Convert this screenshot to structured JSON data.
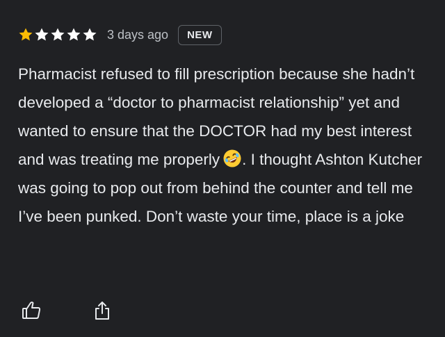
{
  "review": {
    "rating": 1,
    "max_rating": 5,
    "time_ago": "3 days ago",
    "badge": "NEW",
    "text_part1": "Pharmacist refused to fill prescription because she hadn’t developed a “doctor to pharmacist relationship” yet and wanted to ensure that the DOCTOR had my best interest and was treating me properly",
    "emoji": "rolling-on-floor-laughing-emoji",
    "text_part2": ". I thought Ashton Kutcher was going to pop out from behind the counter and tell me I’ve been punked. Don’t waste your time, place is a joke"
  },
  "actions": {
    "like_icon": "thumbs-up-icon",
    "share_icon": "share-icon"
  },
  "colors": {
    "background": "#202124",
    "text": "#e8eaed",
    "star_filled": "#fbbc04",
    "star_empty": "#ffffff"
  }
}
